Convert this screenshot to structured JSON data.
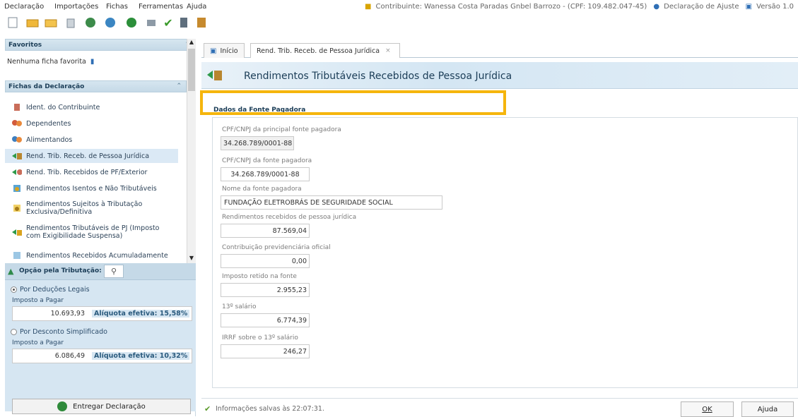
{
  "menu": [
    "Declaração",
    "Importações",
    "Fichas",
    "Ferramentas",
    "Ajuda"
  ],
  "status": {
    "contribuinte": "Contribuinte: Wanessa Costa Paradas Gnbel Barrozo - (CPF: 109.482.047-45)",
    "declaracao": "Declaração de Ajuste",
    "versao": "Versão 1.0"
  },
  "left": {
    "favoritos_title": "Favoritos",
    "favoritos_empty": "Nenhuma ficha favorita",
    "fichas_title": "Fichas da Declaração",
    "items": [
      "Ident. do Contribuinte",
      "Dependentes",
      "Alimentandos",
      "Rend. Trib. Receb. de Pessoa Jurídica",
      "Rend. Trib. Recebidos de PF/Exterior",
      "Rendimentos Isentos e Não Tributáveis",
      "Rendimentos Sujeitos à Tributação Exclusiva/Definitiva",
      "Rendimentos Tributáveis de PJ (Imposto com Exigibilidade Suspensa)",
      "Rendimentos Recebidos Acumuladamente"
    ],
    "opcao_title": "Opção pela Tributação:",
    "deducoes_label": "Por Deduções Legais",
    "imposto_label_1": "Imposto a Pagar",
    "deducoes_valor": "10.693,93",
    "deducoes_aliquota": "Alíquota efetiva: 15,58%",
    "simplificado_label": "Por Desconto Simplificado",
    "imposto_label_2": "Imposto a Pagar",
    "simplificado_valor": "6.086,49",
    "simplificado_aliquota": "Alíquota efetiva: 10,32%",
    "entregar": "Entregar Declaração"
  },
  "tabs": [
    "Início",
    "Rend. Trib. Receb. de Pessoa Jurídica"
  ],
  "page_title": "Rendimentos Tributáveis Recebidos de Pessoa Jurídica",
  "section_title": "Dados da Fonte Pagadora",
  "fields": {
    "principal_label": "CPF/CNPJ da principal fonte pagadora",
    "principal_value": "34.268.789/0001-88",
    "fonte_label": "CPF/CNPJ da fonte pagadora",
    "fonte_value": "34.268.789/0001-88",
    "nome_label": "Nome da fonte pagadora",
    "nome_value": "FUNDAÇÃO ELETROBRÁS DE SEGURIDADE SOCIAL",
    "rend_label": "Rendimentos recebidos de pessoa jurídica",
    "rend_value": "87.569,04",
    "contrib_label": "Contribuição previdenciária oficial",
    "contrib_value": "0,00",
    "imposto_label": "Imposto retido na fonte",
    "imposto_value": "2.955,23",
    "decimo_label": "13º salário",
    "decimo_value": "6.774,39",
    "irrf_label": "IRRF sobre o 13º salário",
    "irrf_value": "246,27"
  },
  "footer": {
    "saved": "Informações salvas às 22:07:31.",
    "ok": "OK",
    "ajuda": "Ajuda"
  },
  "colors": {
    "highlight": "#f5b50d",
    "panel": "#d6e6f2",
    "title": "#1b3d57"
  }
}
